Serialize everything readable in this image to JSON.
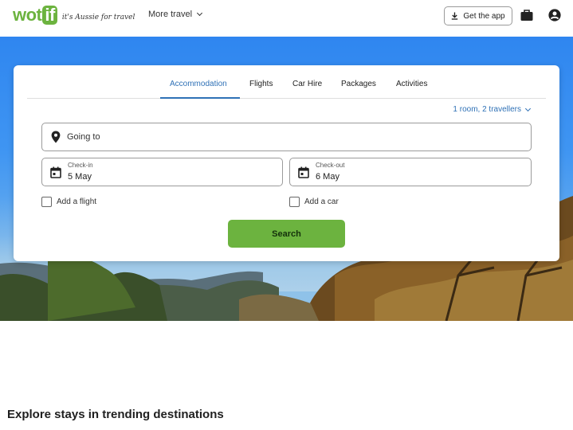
{
  "header": {
    "logo_text": "wot",
    "logo_if": "if",
    "tagline": "it's Aussie for travel",
    "more_travel": "More travel",
    "get_app": "Get the app"
  },
  "search": {
    "tabs": [
      {
        "label": "Accommodation",
        "active": true
      },
      {
        "label": "Flights",
        "active": false
      },
      {
        "label": "Car Hire",
        "active": false
      },
      {
        "label": "Packages",
        "active": false
      },
      {
        "label": "Activities",
        "active": false
      }
    ],
    "travellers": "1 room, 2 travellers",
    "going_to_placeholder": "Going to",
    "checkin": {
      "label": "Check-in",
      "value": "5 May"
    },
    "checkout": {
      "label": "Check-out",
      "value": "6 May"
    },
    "add_flight": "Add a flight",
    "add_car": "Add a car",
    "search_button": "Search"
  },
  "explore_heading": "Explore stays in trending destinations",
  "colors": {
    "brand_green": "#6cb33f",
    "link_blue": "#2f71b6",
    "sky_blue": "#2f86f0"
  },
  "icons": [
    "download-icon",
    "briefcase-icon",
    "account-icon",
    "location-pin-icon",
    "calendar-icon",
    "chevron-down-icon"
  ]
}
